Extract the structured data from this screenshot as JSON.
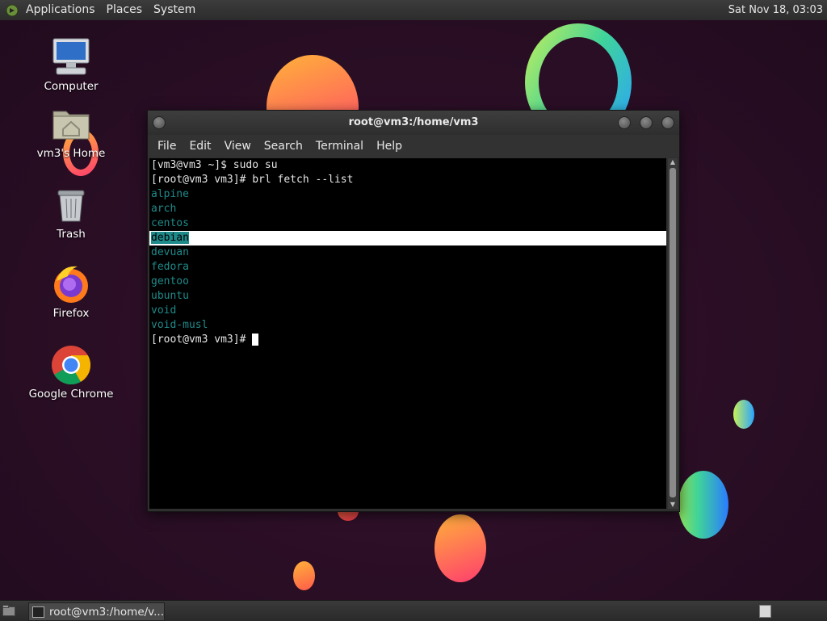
{
  "top_panel": {
    "menus": [
      "Applications",
      "Places",
      "System"
    ],
    "clock": "Sat Nov 18, 03:03"
  },
  "desktop_icons": [
    {
      "label": "Computer",
      "icon": "computer-icon"
    },
    {
      "label": "vm3's Home",
      "icon": "home-folder-icon"
    },
    {
      "label": "Trash",
      "icon": "trash-icon"
    },
    {
      "label": "Firefox",
      "icon": "firefox-icon"
    },
    {
      "label": "Google Chrome",
      "icon": "chrome-icon"
    }
  ],
  "terminal": {
    "title": "root@vm3:/home/vm3",
    "menus": [
      "File",
      "Edit",
      "View",
      "Search",
      "Terminal",
      "Help"
    ],
    "lines": [
      {
        "text": "[vm3@vm3 ~]$ sudo su",
        "kind": "normal"
      },
      {
        "text": "[root@vm3 vm3]# brl fetch --list",
        "kind": "normal"
      },
      {
        "text": "alpine",
        "kind": "dir"
      },
      {
        "text": "arch",
        "kind": "dir"
      },
      {
        "text": "centos",
        "kind": "dir"
      },
      {
        "text": "debian",
        "kind": "selected"
      },
      {
        "text": "devuan",
        "kind": "dir"
      },
      {
        "text": "fedora",
        "kind": "dir"
      },
      {
        "text": "gentoo",
        "kind": "dir"
      },
      {
        "text": "ubuntu",
        "kind": "dir"
      },
      {
        "text": "void",
        "kind": "dir"
      },
      {
        "text": "void-musl",
        "kind": "dir"
      },
      {
        "text": "[root@vm3 vm3]# ",
        "kind": "prompt"
      }
    ]
  },
  "bottom_panel": {
    "task_label": "root@vm3:/home/v..."
  },
  "colors": {
    "dir_text": "#1f8a8a",
    "desktop_bg": "#2b0f26"
  }
}
